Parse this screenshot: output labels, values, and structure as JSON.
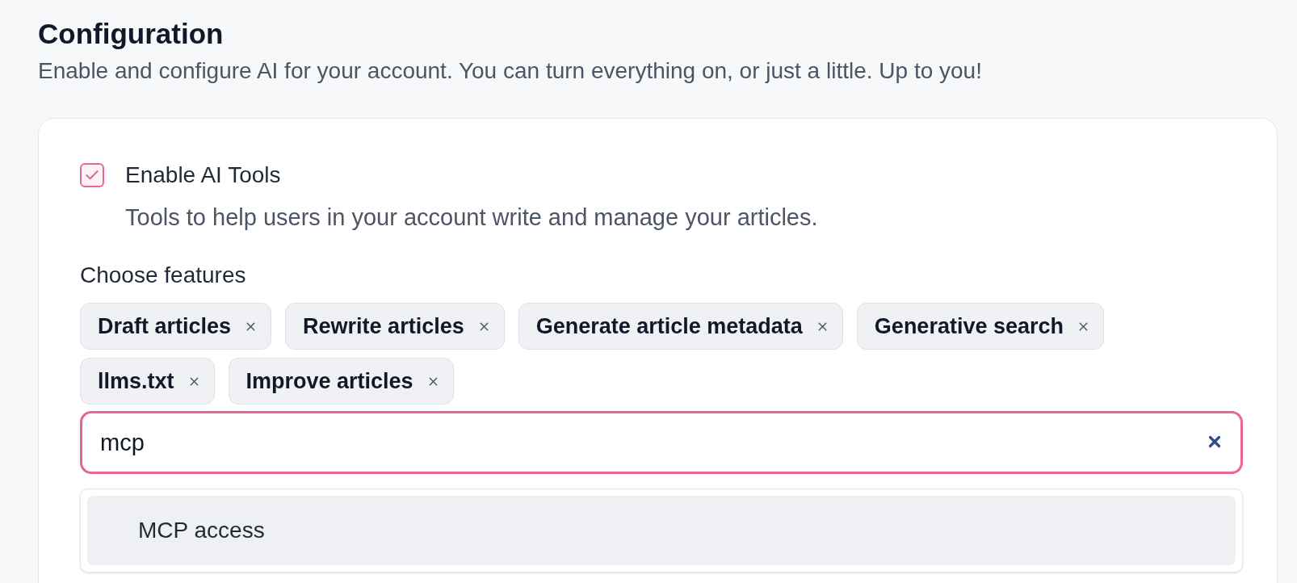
{
  "header": {
    "title": "Configuration",
    "description": "Enable and configure AI for your account. You can turn everything on, or just a little. Up to you!"
  },
  "ai_tools": {
    "label": "Enable AI Tools",
    "checked": true,
    "description": "Tools to help users in your account write and manage your articles."
  },
  "features": {
    "label": "Choose features",
    "chips": [
      "Draft articles",
      "Rewrite articles",
      "Generate article metadata",
      "Generative search",
      "llms.txt",
      "Improve articles"
    ],
    "search": {
      "value": "mcp"
    },
    "options": [
      {
        "label": "MCP access",
        "selected": true
      }
    ]
  }
}
